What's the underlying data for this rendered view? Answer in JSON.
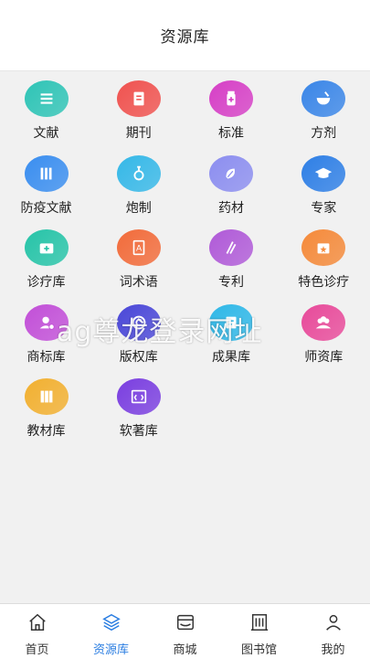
{
  "header": {
    "title": "资源库"
  },
  "grid": {
    "items": [
      {
        "label": "文献",
        "icon": "book-stack-icon",
        "color": "#2ec4b6"
      },
      {
        "label": "期刊",
        "icon": "journal-icon",
        "color": "#f0524f"
      },
      {
        "label": "标准",
        "icon": "medicine-bottle-icon",
        "color": "#d63fc6"
      },
      {
        "label": "方剂",
        "icon": "mortar-icon",
        "color": "#3a86e8"
      },
      {
        "label": "防疫文献",
        "icon": "books-icon",
        "color": "#3a8ef0"
      },
      {
        "label": "炮制",
        "icon": "flask-icon",
        "color": "#35b8e8"
      },
      {
        "label": "药材",
        "icon": "herb-icon",
        "color": "#8c8ef0"
      },
      {
        "label": "专家",
        "icon": "graduation-cap-icon",
        "color": "#2e7fe6"
      },
      {
        "label": "诊疗库",
        "icon": "medical-kit-icon",
        "color": "#26c4a8"
      },
      {
        "label": "词术语",
        "icon": "dictionary-icon",
        "color": "#f26b3a"
      },
      {
        "label": "专利",
        "icon": "patent-icon",
        "color": "#b05ad8"
      },
      {
        "label": "特色诊疗",
        "icon": "feature-box-icon",
        "color": "#f58a3a"
      },
      {
        "label": "商标库",
        "icon": "trademark-user-icon",
        "color": "#c24fd8"
      },
      {
        "label": "版权库",
        "icon": "copyright-icon",
        "color": "#4a47d8"
      },
      {
        "label": "成果库",
        "icon": "achievement-icon",
        "color": "#2fb8e8"
      },
      {
        "label": "师资库",
        "icon": "team-icon",
        "color": "#e84a9a"
      },
      {
        "label": "教材库",
        "icon": "textbooks-icon",
        "color": "#f2b030"
      },
      {
        "label": "软著库",
        "icon": "code-window-icon",
        "color": "#7a3ee0"
      }
    ]
  },
  "watermark": {
    "text": "ag尊龙登录网址"
  },
  "tabbar": {
    "active_color": "#2a7de1",
    "tabs": [
      {
        "label": "首页",
        "icon": "home-icon"
      },
      {
        "label": "资源库",
        "icon": "layers-icon"
      },
      {
        "label": "商城",
        "icon": "shop-icon"
      },
      {
        "label": "图书馆",
        "icon": "library-icon"
      },
      {
        "label": "我的",
        "icon": "user-icon"
      }
    ]
  }
}
